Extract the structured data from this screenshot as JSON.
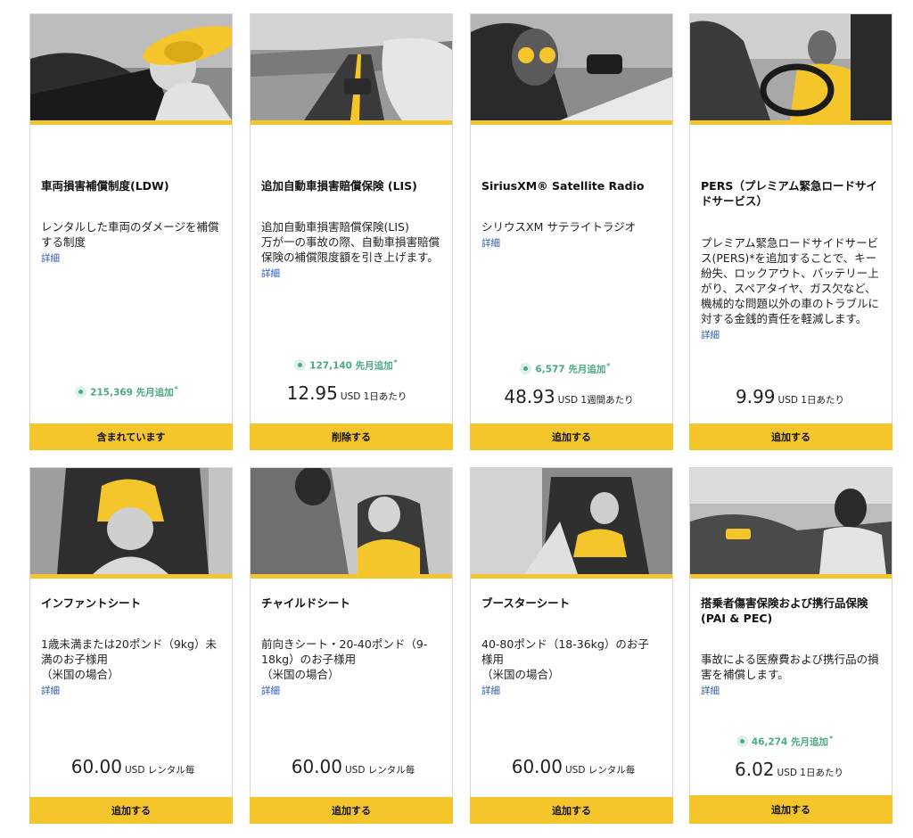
{
  "colors": {
    "accent": "#f4c62c",
    "promo_green": "#4bab81",
    "link_blue": "#2a56c6"
  },
  "cards": [
    {
      "title": "車両損害補償制度(LDW)",
      "desc": "レンタルした車両のダメージを補償する制度",
      "detail": "詳細",
      "promo": "215,369 先月追加",
      "promo_mark": "*",
      "price": "",
      "unit": "",
      "button": "含まれています",
      "icon": "woman-with-sunhat-in-car-photo"
    },
    {
      "title": "追加自動車損害賠償保険 (LIS)",
      "desc": "追加自動車損害賠償保険(LIS)\n万が一の事故の際、自動車損害賠償保険の補償限度額を引き上げます。",
      "detail": "詳細",
      "promo": "127,140 先月追加",
      "promo_mark": "*",
      "price": "12.95",
      "unit": "USD 1日あたり",
      "button": "削除する",
      "icon": "road-from-car-window-photo"
    },
    {
      "title": "SiriusXM® Satellite Radio",
      "desc": "シリウスXM サテライトラジオ",
      "detail": "詳細",
      "promo": "6,577 先月追加",
      "promo_mark": "*",
      "price": "48.93",
      "unit": "USD 1週間あたり",
      "button": "追加する",
      "icon": "woman-with-sunglasses-photo"
    },
    {
      "title": "PERS（プレミアム緊急ロードサイドサービス）",
      "desc": "プレミアム緊急ロードサイドサービス(PERS)*を追加することで、キー紛失、ロックアウト、バッテリー上がり、スペアタイヤ、ガス欠など、機械的な問題以外の車のトラブルに対する金銭的責任を軽減します。",
      "detail": "詳細",
      "promo": "",
      "promo_mark": "",
      "price": "9.99",
      "unit": "USD 1日あたり",
      "button": "追加する",
      "icon": "smiling-woman-driving-photo"
    },
    {
      "title": "インファントシート",
      "desc": "1歳未満または20ポンド（9kg）未満のお子様用\n（米国の場合）",
      "detail": "詳細",
      "promo": "",
      "promo_mark": "",
      "price": "60.00",
      "unit": "USD レンタル毎",
      "button": "追加する",
      "icon": "infant-in-car-seat-photo"
    },
    {
      "title": "チャイルドシート",
      "desc": "前向きシート・20-40ポンド（9-18kg）のお子様用\n（米国の場合）",
      "detail": "詳細",
      "promo": "",
      "promo_mark": "",
      "price": "60.00",
      "unit": "USD レンタル毎",
      "button": "追加する",
      "icon": "child-in-car-seat-photo"
    },
    {
      "title": "ブースターシート",
      "desc": "40-80ポンド（18-36kg）のお子様用\n（米国の場合）",
      "detail": "詳細",
      "promo": "",
      "promo_mark": "",
      "price": "60.00",
      "unit": "USD レンタル毎",
      "button": "追加する",
      "icon": "child-in-booster-seat-photo"
    },
    {
      "title": "搭乗者傷害保険および携行品保険 (PAI & PEC)",
      "desc": "事故による医療費および携行品の損害を補償します。",
      "detail": "詳細",
      "promo": "46,274 先月追加",
      "promo_mark": "*",
      "price": "6.02",
      "unit": "USD 1日あたり",
      "button": "追加する",
      "icon": "convertible-driver-photo"
    }
  ]
}
